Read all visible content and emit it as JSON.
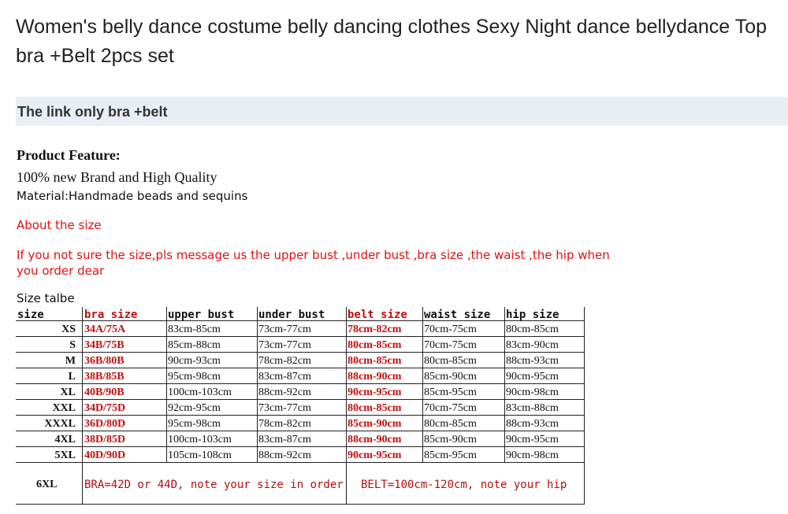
{
  "title": "Women's belly dance costume belly dancing clothes Sexy Night dance bellydance Top bra +Belt 2pcs set",
  "link_note": "The link only bra +belt",
  "feature": {
    "heading": "Product Feature:",
    "line1": "100% new Brand and High Quality",
    "line2": "Material:Handmade beads and sequins"
  },
  "about_size": "About the size",
  "notice": "If you not sure the size,pls message us the upper bust ,under bust ,bra size ,the waist ,the hip when you order dear",
  "size_title": "Size talbe",
  "size_chart": {
    "headers": [
      "size",
      "bra size",
      "upper bust",
      "under bust",
      "belt size",
      "waist size",
      "hip size"
    ],
    "rows": [
      [
        "XS",
        "34A/75A",
        "83cm-85cm",
        "73cm-77cm",
        "78cm-82cm",
        "70cm-75cm",
        "80cm-85cm"
      ],
      [
        "S",
        "34B/75B",
        "85cm-88cm",
        "73cm-77cm",
        "80cm-85cm",
        "70cm-75cm",
        "83cm-90cm"
      ],
      [
        "M",
        "36B/80B",
        "90cm-93cm",
        "78cm-82cm",
        "80cm-85cm",
        "80cm-85cm",
        "88cm-93cm"
      ],
      [
        "L",
        "38B/85B",
        "95cm-98cm",
        "83cm-87cm",
        "88cm-90cm",
        "85cm-90cm",
        "90cm-95cm"
      ],
      [
        "XL",
        "40B/90B",
        "100cm-103cm",
        "88cm-92cm",
        "90cm-95cm",
        "85cm-95cm",
        "90cm-98cm"
      ],
      [
        "XXL",
        "34D/75D",
        "92cm-95cm",
        "73cm-77cm",
        "80cm-85cm",
        "70cm-75cm",
        "83cm-88cm"
      ],
      [
        "XXXL",
        "36D/80D",
        "95cm-98cm",
        "78cm-82cm",
        "85cm-90cm",
        "80cm-85cm",
        "88cm-93cm"
      ],
      [
        "4XL",
        "38D/85D",
        "100cm-103cm",
        "83cm-87cm",
        "88cm-90cm",
        "85cm-90cm",
        "90cm-95cm"
      ],
      [
        "5XL",
        "40D/90D",
        "105cm-108cm",
        "88cm-92cm",
        "90cm-95cm",
        "85cm-95cm",
        "90cm-98cm"
      ]
    ],
    "last_row": {
      "size": "6XL",
      "bra_note": "BRA=42D or 44D, note your size in order",
      "belt_note": "BELT=100cm-120cm, note your hip"
    }
  },
  "colors": {
    "red_text": "#e01010",
    "link_bar": "#e9eef5"
  }
}
